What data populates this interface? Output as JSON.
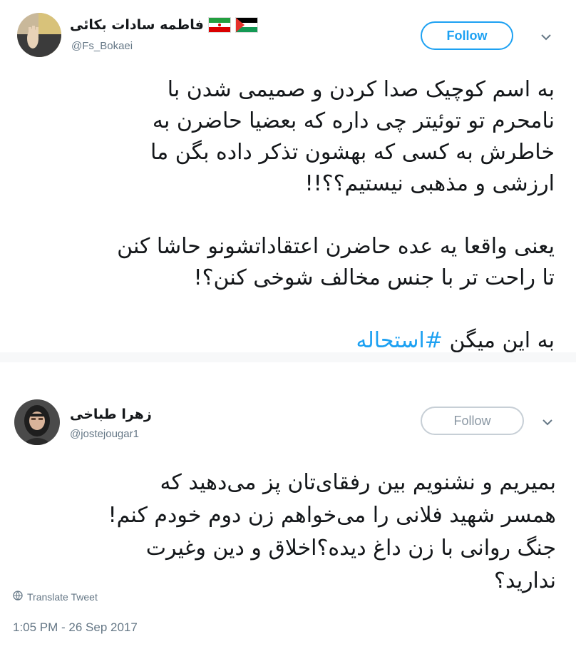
{
  "tweet1": {
    "name": "فاطمه سادات بکائی",
    "handle": "@Fs_Bokaei",
    "follow_label": "Follow",
    "para1": [
      "به اسم کوچیک صدا کردن و صمیمی شدن با",
      "نامحرم تو توئیتر چی داره که بعضیا حاضرن به",
      "خاطرش به کسی که بهشون تذکر داده بگن ما",
      "ارزشی و مذهبی نیستیم؟؟!!"
    ],
    "para2": [
      "یعنی واقعا یه عده حاضرن اعتقاداتشونو حاشا کنن",
      "تا راحت تر با جنس مخالف شوخی کنن؟!"
    ],
    "line_last_prefix": "به این میگن ",
    "hashtag": "#استحاله"
  },
  "tweet2": {
    "name": "زهرا طباخی",
    "handle": "@jostejougar1",
    "follow_label": "Follow",
    "lines": [
      "بمیریم و نشنویم بین رفقای‌تان پز می‌دهید که",
      "همسر شهید فلانی را می‌خواهم زن دوم خودم کنم!",
      "جنگ روانی با زن داغ دیده؟اخلاق و دین وغیرت",
      "ندارید؟"
    ],
    "translate_label": "Translate Tweet",
    "timestamp": "1:05 PM - 26 Sep 2017"
  },
  "colors": {
    "accent": "#1da1f2",
    "text": "#14171a",
    "muted": "#657786"
  },
  "icons": [
    "iran-flag-icon",
    "palestine-flag-icon",
    "chevron-down-icon",
    "globe-icon"
  ]
}
